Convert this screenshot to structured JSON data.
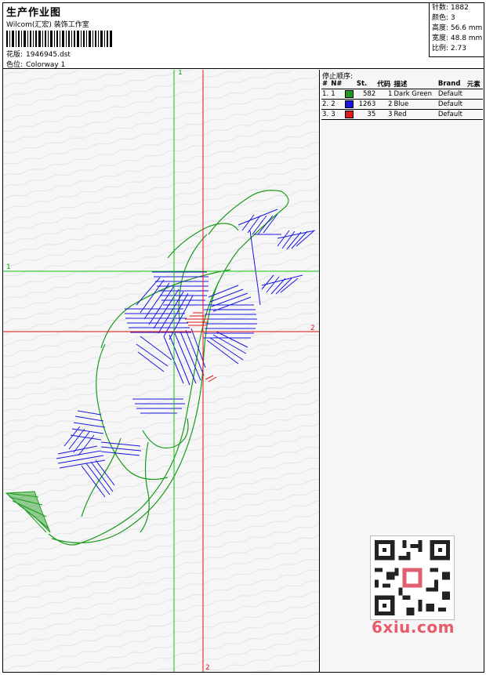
{
  "header": {
    "title": "生产作业图",
    "company": "Wilcom(汇宏) 装饰工作室",
    "design_label": "花版:",
    "design_file": "1946945.dst",
    "colorway_label": "色位:",
    "colorway": "Colorway 1"
  },
  "stats": {
    "stitches": "针数: 1882",
    "colors": "颜色: 3",
    "height": "高度: 56.6 mm",
    "width": "宽度: 48.8 mm",
    "ratio": "比例: 2.73"
  },
  "panel": {
    "title": "停止顺序:",
    "columns": [
      "#",
      "N#",
      "St.",
      "代码",
      "描述",
      "Brand",
      "元素"
    ],
    "rows": [
      {
        "idx": "1.",
        "n": "1",
        "color": "#1a9a1a",
        "st": "582",
        "code": "1",
        "desc": "Dark Green",
        "brand": "Default"
      },
      {
        "idx": "2.",
        "n": "2",
        "color": "#1616e0",
        "st": "1263",
        "code": "2",
        "desc": "Blue",
        "brand": "Default"
      },
      {
        "idx": "3.",
        "n": "3",
        "color": "#e01a1a",
        "st": "35",
        "code": "3",
        "desc": "Red",
        "brand": "Default"
      }
    ]
  },
  "axes": {
    "green_v_label": "1",
    "green_h_label": "1",
    "red_h_label": "2",
    "red_v_label": "2",
    "green_color": "#10c010",
    "red_color": "#e01010"
  },
  "watermark": "6xiu.com",
  "qr_label": "QR code",
  "stitch_colors": {
    "green": "#1a9a1a",
    "blue": "#1616e0",
    "red": "#e01a1a"
  }
}
